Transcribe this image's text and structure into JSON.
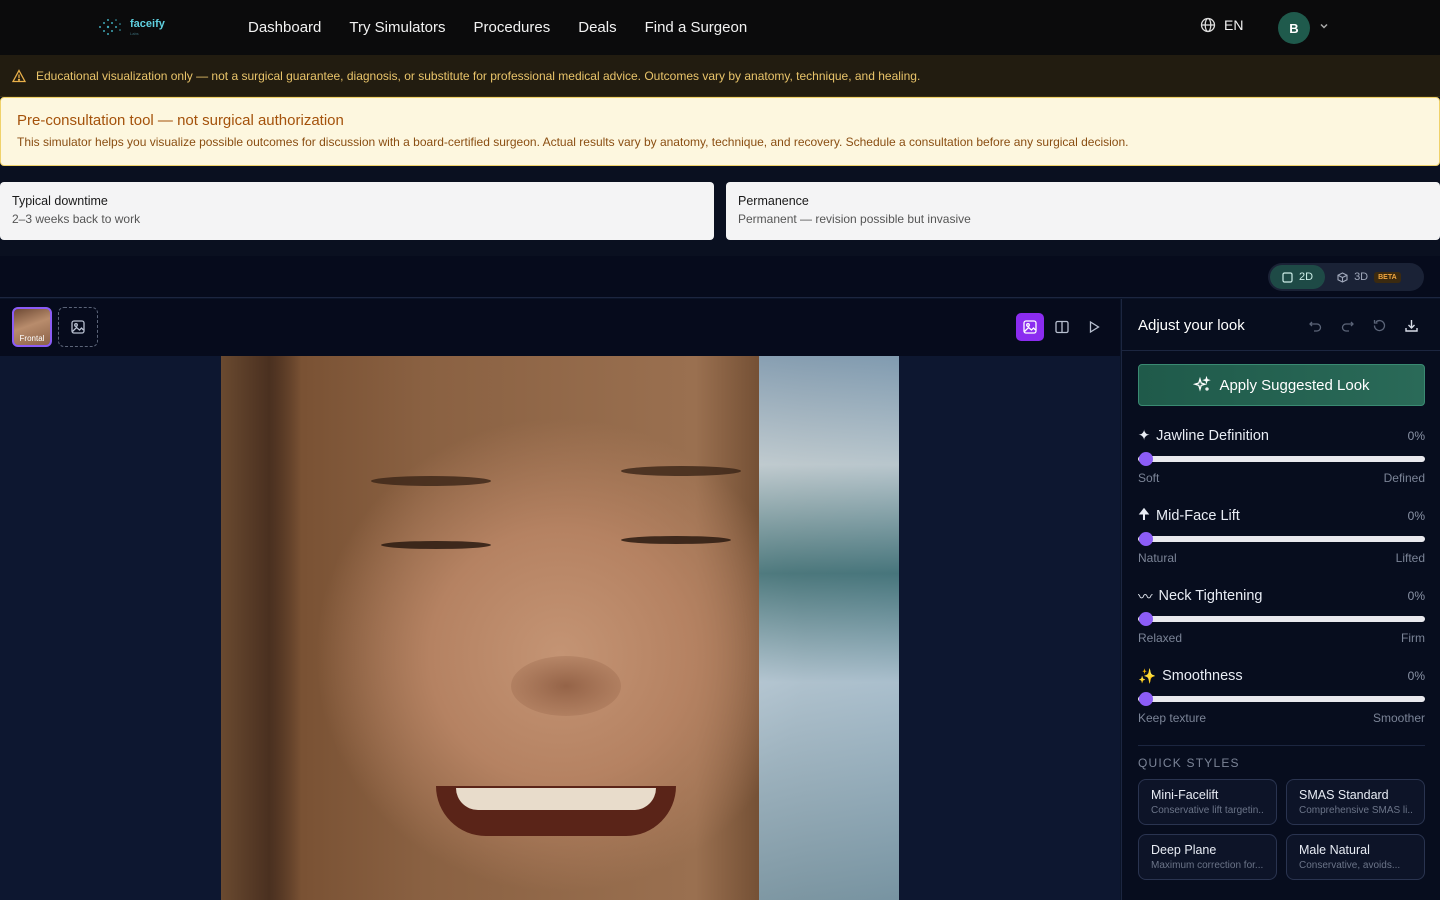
{
  "nav": {
    "logo_name": "faceify",
    "logo_sub": "Labs",
    "links": [
      "Dashboard",
      "Try Simulators",
      "Procedures",
      "Deals",
      "Find a Surgeon"
    ],
    "language": "EN",
    "avatar_initial": "B"
  },
  "warning": {
    "text": "Educational visualization only — not a surgical guarantee, diagnosis, or substitute for professional medical advice. Outcomes vary by anatomy, technique, and healing."
  },
  "preconsult": {
    "title": "Pre-consultation tool — not surgical authorization",
    "body": "This simulator helps you visualize possible outcomes for discussion with a board-certified surgeon. Actual results vary by anatomy, technique, and recovery. Schedule a consultation before any surgical decision."
  },
  "info_cards": [
    {
      "label": "Typical downtime",
      "value": "2–3 weeks back to work"
    },
    {
      "label": "Permanence",
      "value": "Permanent — revision possible but invasive"
    }
  ],
  "mode_toggle": {
    "two_d": "2D",
    "three_d": "3D",
    "beta": "BETA",
    "active": "2D"
  },
  "canvas": {
    "thumb_label": "Frontal"
  },
  "panel": {
    "title": "Adjust your look",
    "apply_label": "Apply Suggested Look",
    "sliders": [
      {
        "icon": "✦",
        "name": "Jawline Definition",
        "value": "0%",
        "min_label": "Soft",
        "max_label": "Defined",
        "level": 0
      },
      {
        "icon": "🠉",
        "name": "Mid-Face Lift",
        "value": "0%",
        "min_label": "Natural",
        "max_label": "Lifted",
        "level": 0
      },
      {
        "icon": "〰",
        "name": "Neck Tightening",
        "value": "0%",
        "min_label": "Relaxed",
        "max_label": "Firm",
        "level": 0
      },
      {
        "icon": "✨",
        "name": "Smoothness",
        "value": "0%",
        "min_label": "Keep texture",
        "max_label": "Smoother",
        "level": 0
      }
    ],
    "quick_styles_title": "QUICK STYLES",
    "quick_styles": [
      {
        "name": "Mini-Facelift",
        "desc": "Conservative lift targetin..."
      },
      {
        "name": "SMAS Standard",
        "desc": "Comprehensive SMAS li..."
      },
      {
        "name": "Deep Plane",
        "desc": "Maximum correction for..."
      },
      {
        "name": "Male Natural",
        "desc": "Conservative, avoids..."
      }
    ]
  },
  "colors": {
    "accent_purple": "#8b5cf6",
    "accent_teal": "#1f5a4a",
    "warning_text": "#e9c46a"
  }
}
